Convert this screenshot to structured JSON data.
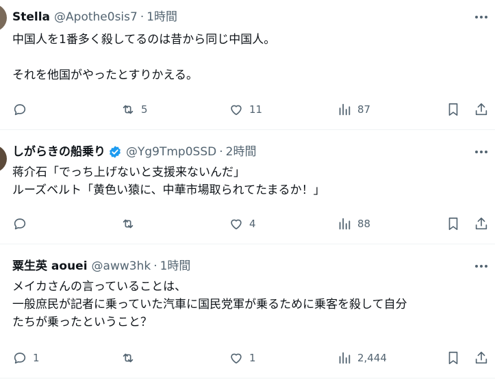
{
  "tweets": [
    {
      "name": "Stella",
      "handle": "@Apothe0sis7",
      "separator": "·",
      "time": "1時間",
      "verified": false,
      "lines": [
        "中国人を1番多く殺してるのは昔から同じ中国人。",
        "",
        "それを他国がやったとすりかえる。"
      ],
      "replies": "",
      "reposts": "5",
      "likes": "11",
      "views": "87"
    },
    {
      "name": "しがらきの船乗り",
      "handle": "@Yg9Tmp0SSD",
      "separator": "·",
      "time": "2時間",
      "verified": true,
      "lines": [
        "蒋介石「でっち上げないと支援来ないんだ」",
        "ルーズベルト「黄色い猿に、中華市場取られてたまるか！」"
      ],
      "replies": "",
      "reposts": "",
      "likes": "4",
      "views": "88"
    },
    {
      "name": "粟生英 aouei",
      "handle": "@aww3hk",
      "separator": "·",
      "time": "1時間",
      "verified": false,
      "lines": [
        "メイカさんの言っていることは、",
        "一般庶民が記者に乗っていた汽車に国民党軍が乗るために乗客を殺して自分",
        "たちが乗ったということ？"
      ],
      "replies": "1",
      "reposts": "",
      "likes": "1",
      "views": "2,444"
    }
  ],
  "colors": {
    "text": "#0f1419",
    "muted": "#536471",
    "verified": "#1d9bf0",
    "divider": "#eff3f4"
  },
  "icons": [
    "reply-icon",
    "repost-icon",
    "like-icon",
    "views-icon",
    "bookmark-icon",
    "share-icon",
    "more-icon",
    "verified-icon"
  ]
}
